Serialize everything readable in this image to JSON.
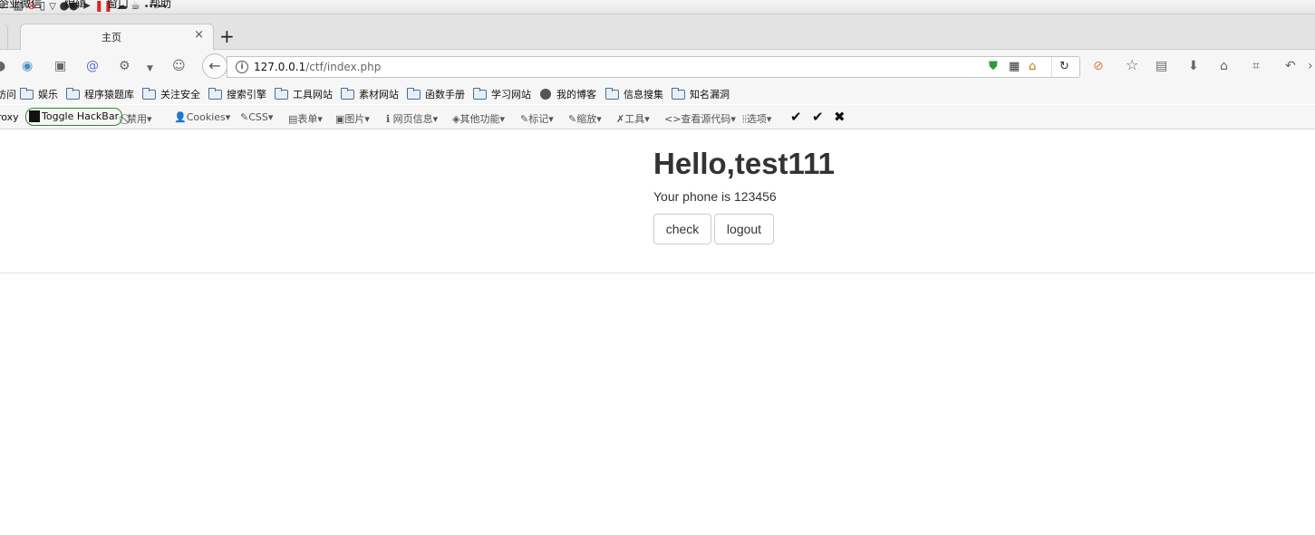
{
  "menubar": {
    "items": [
      "企业微信",
      "编辑",
      "窗口",
      "帮助"
    ],
    "tray_icons": [
      "flag-icon",
      "clipboard-icon",
      "blocked-icon",
      "phone-icon",
      "chevron-down-icon",
      "wechat-icon",
      "send-icon",
      "pause-icon",
      "chat-icon",
      "cup-icon",
      "dots-icon"
    ],
    "dots": "•••••"
  },
  "tabs": [
    {
      "label": "主页",
      "close": "×"
    }
  ],
  "newtab": "+",
  "navbar": {
    "url_host": "127.0.0.1",
    "url_path": "/ctf/index.php",
    "info": "i"
  },
  "bookmarks": [
    {
      "label": "访问",
      "icon": "none"
    },
    {
      "label": "娱乐",
      "icon": "folder"
    },
    {
      "label": "程序猿题库",
      "icon": "folder"
    },
    {
      "label": "关注安全",
      "icon": "folder"
    },
    {
      "label": "搜索引擎",
      "icon": "folder"
    },
    {
      "label": "工具网站",
      "icon": "folder"
    },
    {
      "label": "素材网站",
      "icon": "folder"
    },
    {
      "label": "函数手册",
      "icon": "folder"
    },
    {
      "label": "学习网站",
      "icon": "folder"
    },
    {
      "label": "我的博客",
      "icon": "globe"
    },
    {
      "label": "信息搜集",
      "icon": "folder"
    },
    {
      "label": "知名漏洞",
      "icon": "folder"
    }
  ],
  "hackbar": {
    "proxy": "roxy",
    "toggle": "Toggle HackBar",
    "items": [
      "⃠禁用▾",
      "👤Cookies▾",
      "✎CSS▾",
      "▤表单▾",
      "▣图片▾",
      "ℹ 网页信息▾",
      "◈其他功能▾",
      "✎标记▾",
      "✎缩放▾",
      "✗工具▾",
      "<>查看源代码▾",
      "⦙⦙选项▾"
    ],
    "checks": [
      "✔",
      "✔",
      "✖"
    ]
  },
  "page": {
    "title": "Hello,test111",
    "phone_text": "Your phone is 123456",
    "buttons": [
      "check",
      "logout"
    ]
  }
}
